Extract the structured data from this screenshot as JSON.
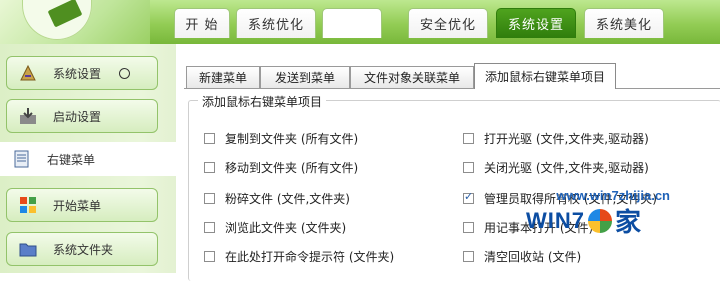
{
  "header": {
    "tabs": [
      {
        "label": "开 始"
      },
      {
        "label": "系统优化"
      },
      {
        "label": ""
      },
      {
        "label": "安全优化"
      },
      {
        "label": "系统设置",
        "active": true
      },
      {
        "label": "系统美化"
      }
    ]
  },
  "sidebar": {
    "items": [
      {
        "label": "系统设置",
        "icon": "gear-paint-icon"
      },
      {
        "label": "启动设置",
        "icon": "startup-tray-icon"
      },
      {
        "label": "右键菜单",
        "icon": "context-menu-icon",
        "active": true
      },
      {
        "label": "开始菜单",
        "icon": "windows-logo-icon"
      },
      {
        "label": "系统文件夹",
        "icon": "folder-icon"
      }
    ]
  },
  "main": {
    "subtabs": [
      {
        "label": "新建菜单"
      },
      {
        "label": "发送到菜单"
      },
      {
        "label": "文件对象关联菜单"
      },
      {
        "label": "添加鼠标右键菜单项目",
        "active": true
      }
    ],
    "group_title": "添加鼠标右键菜单项目",
    "left_options": [
      {
        "label": "复制到文件夹 (所有文件)",
        "checked": false
      },
      {
        "label": "移动到文件夹 (所有文件)",
        "checked": false
      },
      {
        "label": "粉碎文件 (文件,文件夹)",
        "checked": false
      },
      {
        "label": "浏览此文件夹 (文件夹)",
        "checked": false
      },
      {
        "label": "在此处打开命令提示符 (文件夹)",
        "checked": false
      }
    ],
    "right_options": [
      {
        "label": "打开光驱 (文件,文件夹,驱动器)",
        "checked": false
      },
      {
        "label": "关闭光驱 (文件,文件夹,驱动器)",
        "checked": false
      },
      {
        "label": "管理员取得所有权 (文件,文件夹)",
        "checked": true
      },
      {
        "label": "用记事本打开 (文件)",
        "checked": false
      },
      {
        "label": "清空回收站 (文件)",
        "checked": false
      }
    ]
  },
  "watermark": {
    "url": "www.win7zhijia.cn",
    "win": "WIN7",
    "jia": "家"
  }
}
